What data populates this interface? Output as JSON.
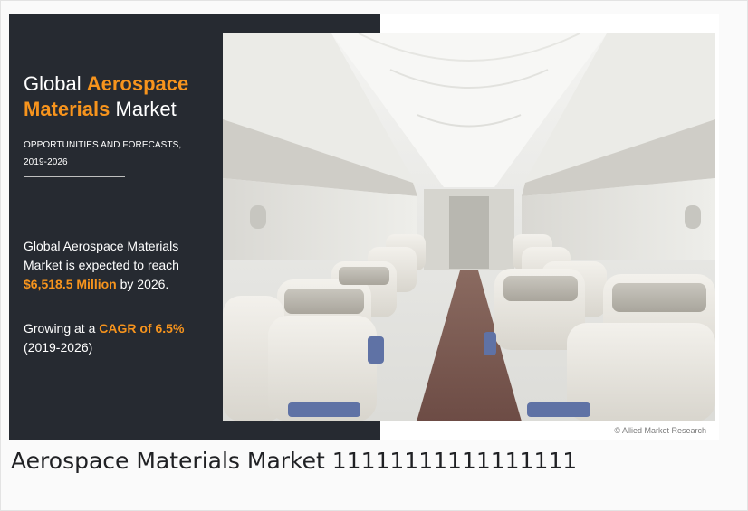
{
  "infographic": {
    "title_part1": "Global ",
    "title_accent1": "Aerospace",
    "title_accent2": "Materials",
    "title_part2": " Market",
    "subtitle_line1": "OPPORTUNITIES AND FORECASTS,",
    "subtitle_line2": "2019-2026",
    "stat1_line1": "Global Aerospace Materials",
    "stat1_line2": "Market is expected to reach",
    "stat1_value": "$6,518.5 Million",
    "stat1_suffix": " by 2026.",
    "stat2_prefix": "Growing at a ",
    "stat2_value": "CAGR of 6.5%",
    "stat2_period": "(2019-2026)",
    "copyright": "© Allied Market Research",
    "accent_color": "#f7941d",
    "panel_color": "#262a31"
  },
  "caption": {
    "text": "Aerospace Materials Market 11111111111111111"
  }
}
